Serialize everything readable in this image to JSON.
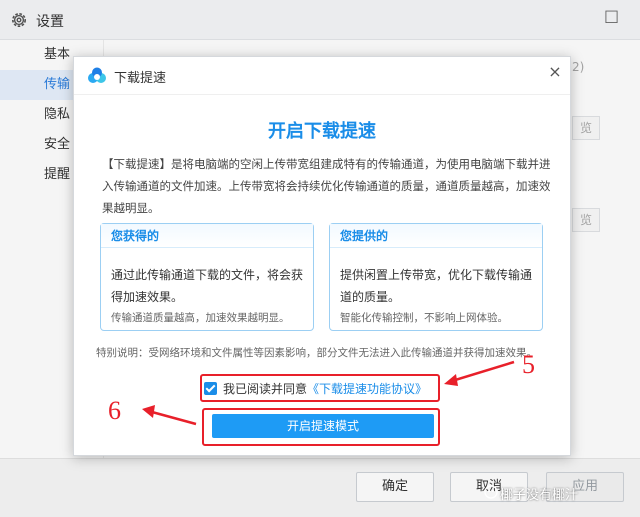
{
  "settings": {
    "title": "设置",
    "close_label": "□",
    "sidebar": [
      {
        "label": "基本",
        "active": false
      },
      {
        "label": "传输",
        "active": true
      },
      {
        "label": "隐私",
        "active": false
      },
      {
        "label": "安全",
        "active": false
      },
      {
        "label": "提醒",
        "active": false
      }
    ],
    "bg_fragments": {
      "right_1": "2)",
      "right_2": "览",
      "right_3": "览"
    },
    "footer": {
      "ok_label": "确定",
      "cancel_label": "取消",
      "apply_label": "应用"
    }
  },
  "dialog": {
    "title": "下载提速",
    "close_label": "×",
    "heading": "开启下载提速",
    "description": "【下载提速】是将电脑端的空闲上传带宽组建成特有的传输通道，为使用电脑端下载并进入传输通道的文件加速。上传带宽将会持续优化传输通道的质量，通道质量越高，加速效果越明显。",
    "cards": [
      {
        "title": "您获得的",
        "main": "通过此传输通道下载的文件，将会获得加速效果。",
        "sub": "传输通道质量越高，加速效果越明显。"
      },
      {
        "title": "您提供的",
        "main": "提供闲置上传带宽，优化下载传输通道的质量。",
        "sub": "智能化传输控制，不影响上网体验。"
      }
    ],
    "note": "特别说明：受网络环境和文件属性等因素影响，部分文件无法进入此传输通道并获得加速效果。",
    "agree_text": "我已阅读并同意",
    "agree_link": "《下载提速功能协议》",
    "agree_checked": true,
    "primary_button": "开启提速模式"
  },
  "annotations": {
    "step_5": "5",
    "step_6": "6",
    "color": "#e8202a"
  },
  "watermark": "椰子没有椰汁",
  "colors": {
    "accent": "#1a8de8",
    "button": "#1e9bf5",
    "annotation": "#e8202a"
  }
}
